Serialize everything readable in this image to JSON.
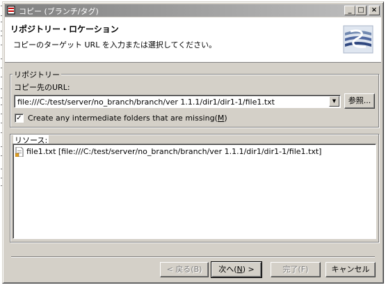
{
  "window": {
    "title": "コピー (ブランチ/タグ)",
    "controls": {
      "minimize": "_",
      "maximize": "□",
      "close": "×"
    }
  },
  "header": {
    "title": "リポジトリー・ロケーション",
    "description": "コピーのターゲット URL を入力または選択してください。",
    "banner_icon": "svn-repository-banner-icon"
  },
  "repository_group": {
    "label": "リポジトリー",
    "url_label": "コピー先のURL:",
    "url_value": "file:///C:/test/server/no_branch/branch/ver 1.1.1/dir1/dir1-1/file1.txt",
    "browse_button": "参照...",
    "checkbox_label": "Create any intermediate folders that are missing(",
    "checkbox_mnemonic": "M",
    "checkbox_label_end": ")",
    "checkbox_checked": true
  },
  "resources_group": {
    "label": "リソース:",
    "items": [
      {
        "icon": "file-icon",
        "text": "file1.txt [file:///C:/test/server/no_branch/branch/ver 1.1.1/dir1/dir1-1/file1.txt]"
      }
    ]
  },
  "footer": {
    "back_button": "< 戻る(B)",
    "next_button_pre": "次へ(",
    "next_button_mnemonic": "N",
    "next_button_post": ") >",
    "finish_button": "完了(F)",
    "cancel_button": "キャンセル"
  }
}
